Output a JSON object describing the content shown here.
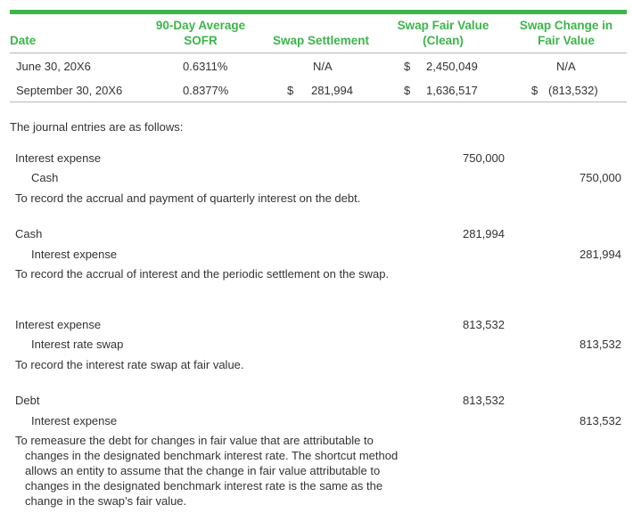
{
  "table": {
    "headers": {
      "date": "Date",
      "sofr_line1": "90-Day Average",
      "sofr_line2": "SOFR",
      "settlement": "Swap Settlement",
      "fair_value_line1": "Swap Fair Value",
      "fair_value_line2": "(Clean)",
      "change_line1": "Swap Change in",
      "change_line2": "Fair Value"
    },
    "rows": [
      {
        "date": "June 30, 20X6",
        "sofr": "0.6311%",
        "settlement_dollar": "",
        "settlement": "N/A",
        "fair_value_dollar": "$",
        "fair_value": "2,450,049",
        "change_dollar": "",
        "change": "N/A"
      },
      {
        "date": "September 30, 20X6",
        "sofr": "0.8377%",
        "settlement_dollar": "$",
        "settlement": "281,994",
        "fair_value_dollar": "$",
        "fair_value": "1,636,517",
        "change_dollar": "$",
        "change": "(813,532)"
      }
    ]
  },
  "intro": "The journal entries are as follows:",
  "entries": [
    {
      "debit_account": "Interest expense",
      "debit_amount": "750,000",
      "credit_account": "Cash",
      "credit_amount": "750,000",
      "description": "To record the accrual and payment of quarterly interest on the debt."
    },
    {
      "debit_account": "Cash",
      "debit_amount": "281,994",
      "credit_account": "Interest expense",
      "credit_amount": "281,994",
      "description": "To record the accrual of interest and the periodic settlement on the swap."
    },
    {
      "debit_account": "Interest expense",
      "debit_amount": "813,532",
      "credit_account": "Interest rate swap",
      "credit_amount": "813,532",
      "description": "To record the interest rate swap at fair value."
    },
    {
      "debit_account": "Debt",
      "debit_amount": "813,532",
      "credit_account": "Interest expense",
      "credit_amount": "813,532",
      "description": "To remeasure the debt for changes in fair value that are attributable to changes in the designated benchmark interest rate. The shortcut method allows an entity to assume that the change in fair value attributable to changes in the designated benchmark interest rate is the same as the change in the swap’s fair value."
    }
  ],
  "colors": {
    "accent": "#3cb54a",
    "rule": "#b8b8b8",
    "text": "#333333"
  }
}
